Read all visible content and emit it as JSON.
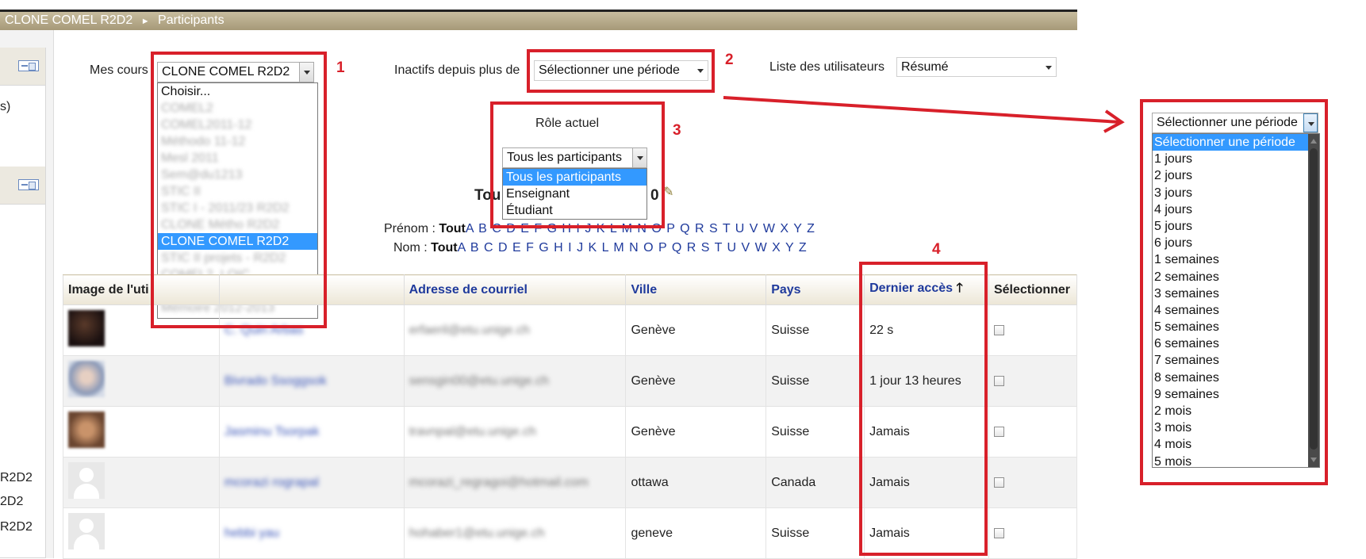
{
  "breadcrumb": {
    "course": "CLONE COMEL R2D2",
    "separator": "►",
    "page": "Participants"
  },
  "left_panel": {
    "partial_text": "s)",
    "course_fragments": [
      "R2D2",
      "2D2",
      "R2D2"
    ]
  },
  "controls": {
    "my_courses_label": "Mes cours",
    "my_courses_value": "CLONE COMEL R2D2",
    "inactive_label": "Inactifs depuis plus de",
    "inactive_value": "Sélectionner une période",
    "user_list_label": "Liste des utilisateurs",
    "user_list_value": "Résumé",
    "role_label": "Rôle actuel",
    "role_value": "Tous les participants"
  },
  "courses_dropdown": {
    "items": [
      {
        "label": "Choisir...",
        "blurred": false,
        "selected": false
      },
      {
        "label": "COMEL2",
        "blurred": true,
        "selected": false
      },
      {
        "label": "COMEL2011-12",
        "blurred": true,
        "selected": false
      },
      {
        "label": "Méthodo 11-12",
        "blurred": true,
        "selected": false
      },
      {
        "label": "Mesl 2011",
        "blurred": true,
        "selected": false
      },
      {
        "label": "Sem@du1213",
        "blurred": true,
        "selected": false
      },
      {
        "label": "STIC II",
        "blurred": true,
        "selected": false
      },
      {
        "label": "STIC I - 2011/23 R2D2",
        "blurred": true,
        "selected": false
      },
      {
        "label": "CLONE Métho R2D2",
        "blurred": true,
        "selected": false
      },
      {
        "label": "CLONE COMEL R2D2",
        "blurred": false,
        "selected": true
      },
      {
        "label": "STIC II projets - R2D2",
        "blurred": true,
        "selected": false
      },
      {
        "label": "COMEL2_LOIC",
        "blurred": true,
        "selected": false
      },
      {
        "label": "Projet Ipsit",
        "blurred": true,
        "selected": false
      },
      {
        "label": "Mémoire 2012-2013",
        "blurred": true,
        "selected": false
      }
    ]
  },
  "role_dropdown": {
    "items": [
      {
        "label": "Tous les participants",
        "selected": true
      },
      {
        "label": "Enseignant",
        "selected": false
      },
      {
        "label": "Étudiant",
        "selected": false
      }
    ]
  },
  "period_dropdown": {
    "value": "Sélectionner une période",
    "items": [
      {
        "label": "Sélectionner une période",
        "selected": true
      },
      {
        "label": "1 jours",
        "selected": false
      },
      {
        "label": "2 jours",
        "selected": false
      },
      {
        "label": "3 jours",
        "selected": false
      },
      {
        "label": "4 jours",
        "selected": false
      },
      {
        "label": "5 jours",
        "selected": false
      },
      {
        "label": "6 jours",
        "selected": false
      },
      {
        "label": "1 semaines",
        "selected": false
      },
      {
        "label": "2 semaines",
        "selected": false
      },
      {
        "label": "3 semaines",
        "selected": false
      },
      {
        "label": "4 semaines",
        "selected": false
      },
      {
        "label": "5 semaines",
        "selected": false
      },
      {
        "label": "6 semaines",
        "selected": false
      },
      {
        "label": "7 semaines",
        "selected": false
      },
      {
        "label": "8 semaines",
        "selected": false
      },
      {
        "label": "9 semaines",
        "selected": false
      },
      {
        "label": "2 mois",
        "selected": false
      },
      {
        "label": "3 mois",
        "selected": false
      },
      {
        "label": "4 mois",
        "selected": false
      },
      {
        "label": "5 mois",
        "selected": false
      }
    ]
  },
  "annotations": [
    "1",
    "2",
    "3",
    "4"
  ],
  "heading_fragments": {
    "left": "Tou",
    "right": "0"
  },
  "alpha_filter": {
    "firstname_label": "Prénom :",
    "lastname_label": "Nom :",
    "all": "Tout",
    "letters": "A B C D E F G H I J K L M N O P Q R S T U V W X Y Z"
  },
  "table": {
    "headers": [
      "Image de l'uti",
      "",
      "Adresse de courriel",
      "Ville",
      "Pays",
      "Dernier accès",
      "Sélectionner"
    ],
    "sort_icon": "arrow-up-icon",
    "rows": [
      {
        "avatar": "dark",
        "name": "C. Quin Arbas",
        "email": "erfaeril@etu.unige.ch",
        "city": "Genève",
        "country": "Suisse",
        "last_access": "22 s"
      },
      {
        "avatar": "face",
        "name": "Bivrado Ssoggsok",
        "email": "sensgin00@etu.unige.ch",
        "city": "Genève",
        "country": "Suisse",
        "last_access": "1 jour 13 heures"
      },
      {
        "avatar": "brown",
        "name": "Jasminu Tsorpak",
        "email": "travnpal@etu.unige.ch",
        "city": "Genève",
        "country": "Suisse",
        "last_access": "Jamais"
      },
      {
        "avatar": "default",
        "name": "mcorazi rograpal",
        "email": "mcorazi_regragoi@hotmail.com",
        "city": "ottawa",
        "country": "Canada",
        "last_access": "Jamais"
      },
      {
        "avatar": "default",
        "name": "hebbi yau",
        "email": "hohaber1@etu.unige.ch",
        "city": "geneve",
        "country": "Suisse",
        "last_access": "Jamais"
      }
    ]
  },
  "colors": {
    "annotation_red": "#d8202a",
    "link_blue": "#1f3a9c",
    "highlight": "#3399ff"
  }
}
